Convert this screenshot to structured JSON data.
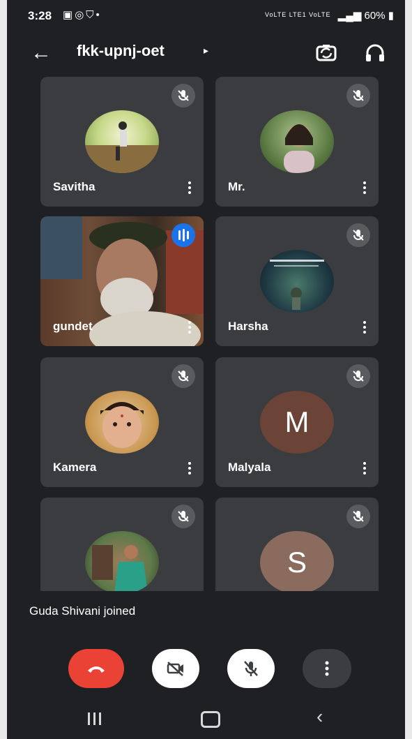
{
  "status_bar": {
    "time": "3:28",
    "icons": [
      "gallery-icon",
      "whatsapp-icon",
      "shield-icon",
      "dot"
    ],
    "network_text": "VoLTE LTE1 VoLTE",
    "battery": "60%"
  },
  "header": {
    "title": "fkk-upnj-oet",
    "caret": "▸"
  },
  "tiles": [
    {
      "name": "Savitha",
      "muted": true,
      "kind": "photo",
      "avatar_color": "#9bbb6a"
    },
    {
      "name": "Mr.",
      "muted": true,
      "kind": "photo",
      "avatar_color": "#6f8f5a"
    },
    {
      "name": "gundet",
      "muted": false,
      "kind": "video",
      "speaking": true
    },
    {
      "name": "Harsha",
      "muted": true,
      "kind": "photo",
      "avatar_color": "#2c4a5a"
    },
    {
      "name": "Kamera",
      "muted": true,
      "kind": "photo",
      "avatar_color": "#c9a17a"
    },
    {
      "name": "Malyala",
      "muted": true,
      "kind": "letter",
      "letter": "M",
      "avatar_color": "#6b4337"
    },
    {
      "name": "",
      "muted": true,
      "kind": "photo",
      "avatar_color": "#4f7a4a"
    },
    {
      "name": "",
      "muted": true,
      "kind": "letter",
      "letter": "S",
      "avatar_color": "#8b6b5e"
    }
  ],
  "toast": "Guda Shivani joined",
  "colors": {
    "background": "#1f2023",
    "tile": "#3b3c40",
    "end_call": "#ea4335",
    "speaking": "#1a73e8"
  }
}
